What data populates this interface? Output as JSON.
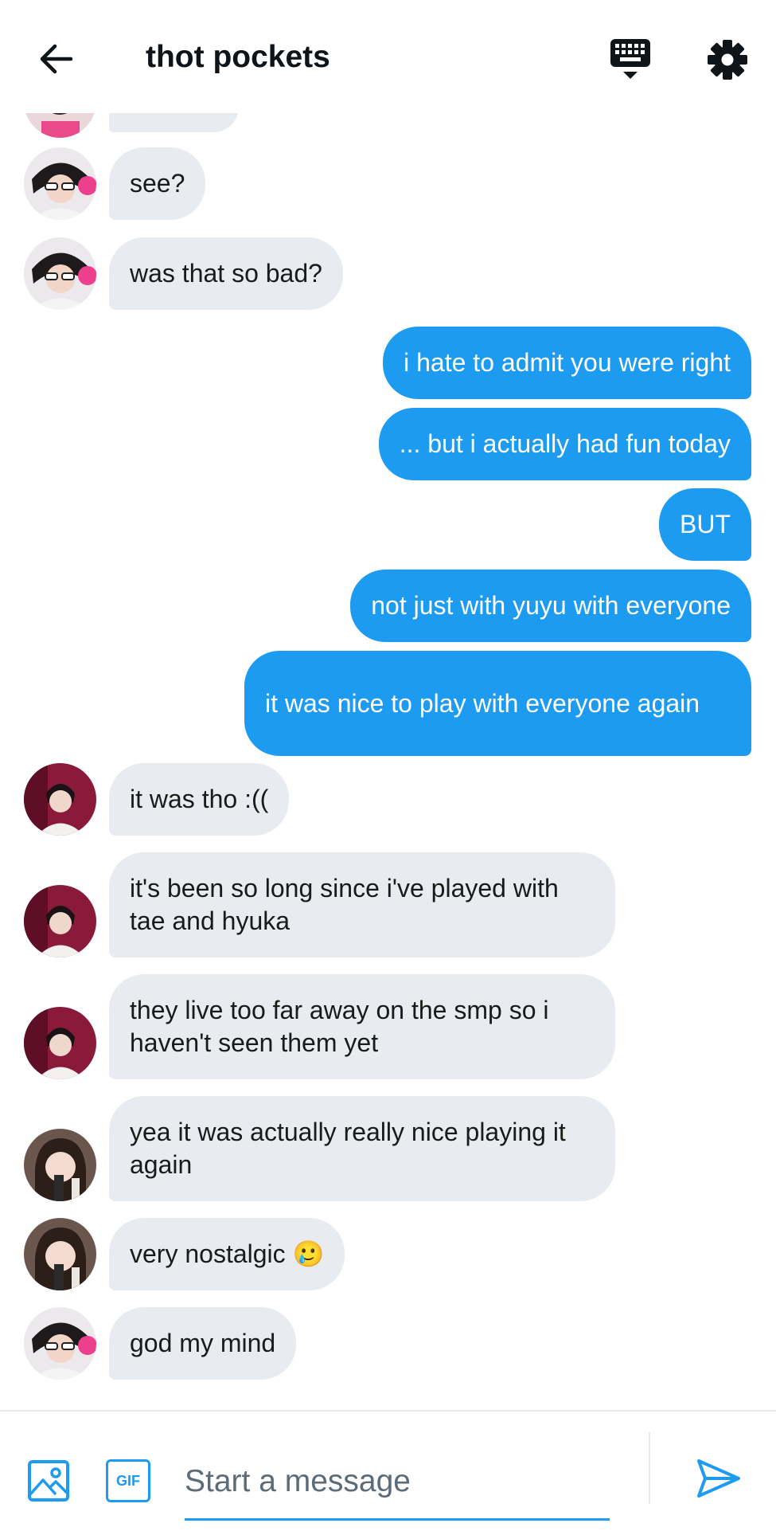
{
  "header": {
    "title": "thot pockets",
    "icons": {
      "back": "back-arrow-icon",
      "keyboard": "keyboard-icon",
      "settings": "gear-icon"
    }
  },
  "messages": [
    {
      "id": "m1",
      "direction": "received",
      "avatar": "avatar-a",
      "text": "see?"
    },
    {
      "id": "m2",
      "direction": "received",
      "avatar": "avatar-a",
      "text": "was that so bad?"
    },
    {
      "id": "m3",
      "direction": "sent",
      "text": "i hate to admit you were right"
    },
    {
      "id": "m4",
      "direction": "sent",
      "text": "... but i actually had fun today"
    },
    {
      "id": "m5",
      "direction": "sent",
      "text": "BUT"
    },
    {
      "id": "m6",
      "direction": "sent",
      "text": "not just with yuyu with everyone"
    },
    {
      "id": "m7",
      "direction": "sent",
      "text": "it was nice to play with everyone again"
    },
    {
      "id": "m8",
      "direction": "received",
      "avatar": "avatar-b",
      "text": "it was tho :(("
    },
    {
      "id": "m9",
      "direction": "received",
      "avatar": "avatar-b",
      "text": "it's been so long since i've played with tae and hyuka"
    },
    {
      "id": "m10",
      "direction": "received",
      "avatar": "avatar-b",
      "text": "they live too far away on the smp so i haven't seen them yet"
    },
    {
      "id": "m11",
      "direction": "received",
      "avatar": "avatar-c",
      "text": "yea it was actually really nice playing it again"
    },
    {
      "id": "m12",
      "direction": "received",
      "avatar": "avatar-c",
      "text": "very nostalgic 🥲"
    },
    {
      "id": "m13",
      "direction": "received",
      "avatar": "avatar-a",
      "text": "god my mind"
    }
  ],
  "composer": {
    "placeholder": "Start a message",
    "gif_label": "GIF",
    "icons": {
      "image": "image-icon",
      "send": "send-icon"
    }
  },
  "colors": {
    "accent": "#1d9bf0",
    "received_bubble": "#e8ebef",
    "sent_text": "#ffffff",
    "text": "#0f1419"
  }
}
